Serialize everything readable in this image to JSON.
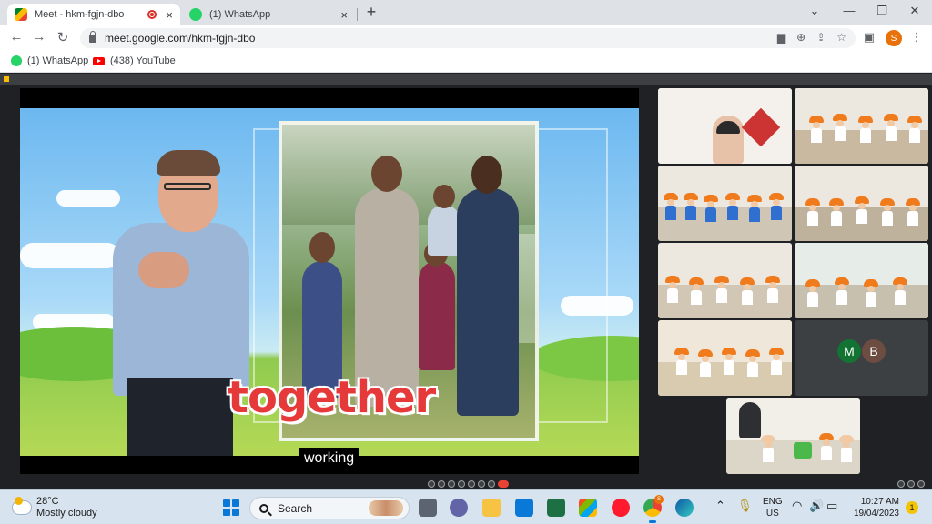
{
  "browser": {
    "tabs": [
      {
        "title": "Meet - hkm-fgjn-dbo",
        "active": true
      },
      {
        "title": "(1) WhatsApp",
        "active": false
      }
    ],
    "new_tab_label": "+",
    "close_label": "×",
    "url": "meet.google.com/hkm-fgjn-dbo",
    "profile_initial": "S",
    "bookmarks": [
      {
        "label": "(1) WhatsApp",
        "icon": "whatsapp-icon"
      },
      {
        "label": "(438) YouTube",
        "icon": "youtube-icon"
      }
    ],
    "colors": {
      "tab_bar": "#dee1e6",
      "recording": "#d93025",
      "profile": "#e8710a"
    }
  },
  "meet": {
    "presentation": {
      "overlay_word": "together",
      "caption": "working"
    },
    "participants_tiles": 9,
    "other_avatars": [
      {
        "initial": "M",
        "color": "#137333"
      },
      {
        "initial": "B",
        "color": "#6d4c41"
      }
    ]
  },
  "taskbar": {
    "weather_temp": "28°C",
    "weather_desc": "Mostly cloudy",
    "search_label": "Search",
    "lang_line1": "ENG",
    "lang_line2": "US",
    "time": "10:27 AM",
    "date": "19/04/2023",
    "notification_count": "1",
    "chrome_badge": "S"
  }
}
